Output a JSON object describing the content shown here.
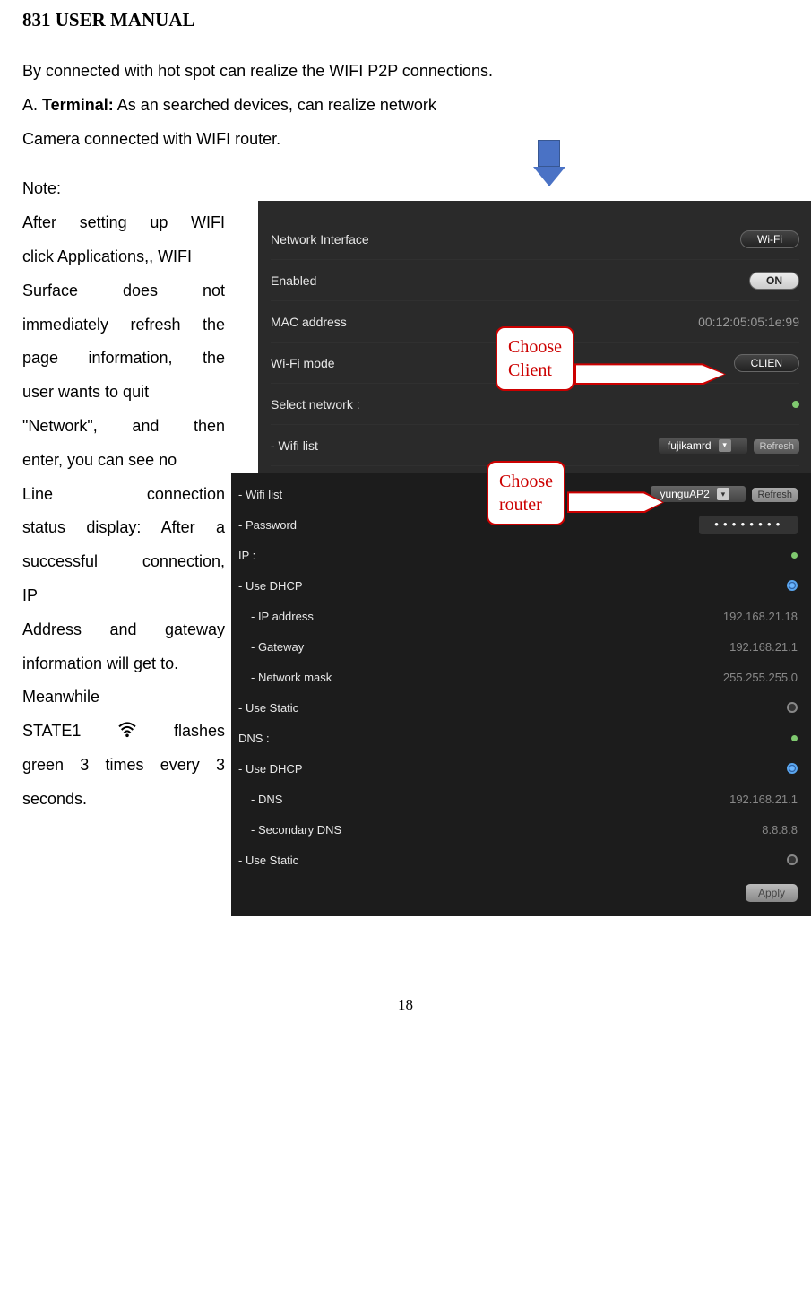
{
  "title": "831 USER MANUAL",
  "intro_p1": "By connected with hot spot can realize the WIFI P2P connections.",
  "intro_a": "A. ",
  "intro_terminal": "Terminal:",
  "intro_p2": " As an searched devices, can realize network",
  "intro_p3": "Camera connected with WIFI router.",
  "note_heading": "Note:",
  "note_l1": "After setting up WIFI",
  "note_l2": "click Applications,, WIFI",
  "note_l3": "Surface does not",
  "note_l4": "immediately refresh the",
  "note_l5": "page information, the",
  "note_l6": "user wants to quit",
  "note_l7": "\"Network\", and then",
  "note_l8": "enter, you can see no",
  "note_l9": "Line connection",
  "note_l10": "status display: After a",
  "note_l11": "successful connection,",
  "note_l12": "IP",
  "note_l13": "Address and gateway",
  "note_l14": "information will get to.",
  "note_l15": "Meanwhile",
  "note_l16a": "STATE1 ",
  "note_l16b": " flashes",
  "note_l17": "green 3 times every 3",
  "note_l18": "seconds.",
  "callout1_l1": "Choose",
  "callout1_l2": "Client",
  "callout2_l1": "Choose",
  "callout2_l2": "router",
  "panel1": {
    "network_interface": "Network Interface",
    "wifi_pill": "Wi-Fi",
    "enabled": "Enabled",
    "on": "ON",
    "mac_label": "MAC address",
    "mac_val": "00:12:05:05:1e:99",
    "wifi_mode": "Wi-Fi mode",
    "client": "CLIEN",
    "select_network": "Select network :",
    "wifi_list": "- Wifi list",
    "network1": "fujikamrd",
    "refresh": "Refresh"
  },
  "panel2": {
    "wifi_list": "- Wifi list",
    "network2": "yunguAP2",
    "refresh": "Refresh",
    "password_label": "- Password",
    "password_val": "••••••••",
    "ip": "IP :",
    "use_dhcp": "- Use DHCP",
    "ip_address_label": "- IP address",
    "ip_address_val": "192.168.21.18",
    "gateway_label": "- Gateway",
    "gateway_val": "192.168.21.1",
    "netmask_label": "- Network mask",
    "netmask_val": "255.255.255.0",
    "use_static": "- Use Static",
    "dns": "DNS :",
    "use_dhcp2": "- Use DHCP",
    "dns_label": "- DNS",
    "dns_val": "192.168.21.1",
    "dns2_label": "- Secondary DNS",
    "dns2_val": "8.8.8.8",
    "use_static2": "- Use Static",
    "apply": "Apply"
  },
  "page_num": "18"
}
